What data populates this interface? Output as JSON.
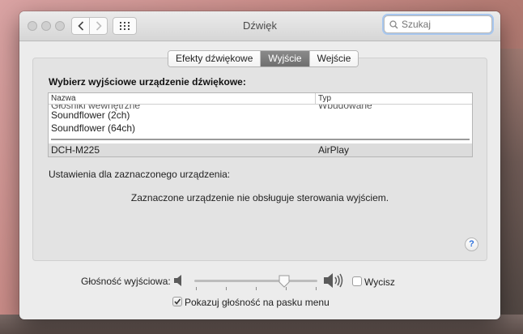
{
  "window": {
    "title": "Dźwięk"
  },
  "search": {
    "placeholder": "Szukaj"
  },
  "tabs": [
    {
      "label": "Efekty dźwiękowe"
    },
    {
      "label": "Wyjście"
    },
    {
      "label": "Wejście"
    }
  ],
  "active_tab": "Wyjście",
  "output": {
    "heading": "Wybierz wyjściowe urządzenie dźwiękowe:",
    "columns": {
      "name": "Nazwa",
      "type": "Typ"
    },
    "devices": [
      {
        "name": "Głośniki wewnętrzne",
        "type": "Wbudowane"
      },
      {
        "name": "Soundflower (2ch)",
        "type": ""
      },
      {
        "name": "Soundflower (64ch)",
        "type": ""
      },
      {
        "name": "DCH-M225",
        "type": "AirPlay"
      }
    ],
    "selected_device": "DCH-M225"
  },
  "settings": {
    "label": "Ustawienia dla zaznaczonego urządzenia:",
    "message": "Zaznaczone urządzenie nie obsługuje sterowania wyjściem."
  },
  "volume": {
    "label": "Głośność wyjściowa:",
    "level": 0.73,
    "mute_label": "Wycisz",
    "muted": false
  },
  "menu_bar": {
    "label": "Pokazuj głośność na pasku menu",
    "checked": true
  },
  "colors": {
    "accent": "#2b6fdc",
    "selected_row": "#dcdcdc",
    "active_tab": "#7d7d7d"
  }
}
